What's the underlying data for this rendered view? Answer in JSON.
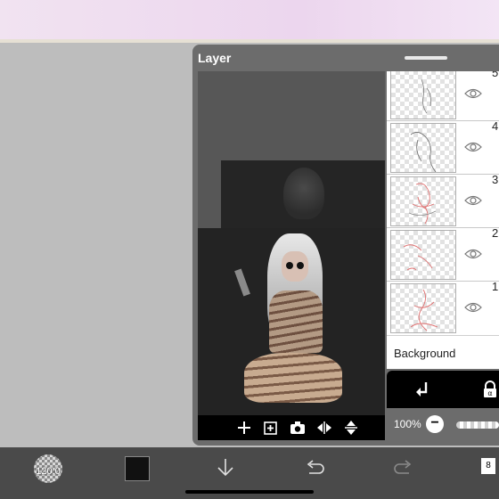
{
  "panel": {
    "title": "Layer"
  },
  "layers": [
    {
      "number": "5",
      "visible": true
    },
    {
      "number": "4",
      "visible": true
    },
    {
      "number": "3",
      "visible": true
    },
    {
      "number": "2",
      "visible": true
    },
    {
      "number": "1",
      "visible": true
    }
  ],
  "background_layer": {
    "label": "Background"
  },
  "opacity": {
    "label": "100%",
    "minus": "−",
    "value_percent": 100
  },
  "toolbar": {
    "brush_size": "120.0",
    "layer_count": "8"
  },
  "icons": {
    "preview": [
      "add-layer-icon",
      "add-copy-icon",
      "camera-icon",
      "flip-horizontal-icon",
      "flip-vertical-icon"
    ],
    "bottom": [
      "brush-size-icon",
      "color-swatch",
      "down-arrow-icon",
      "undo-icon",
      "redo-icon",
      "layers-icon"
    ]
  },
  "colors": {
    "panel": "#6c6c6c",
    "accent": "#ffffff",
    "sketch_red": "#e07070"
  }
}
